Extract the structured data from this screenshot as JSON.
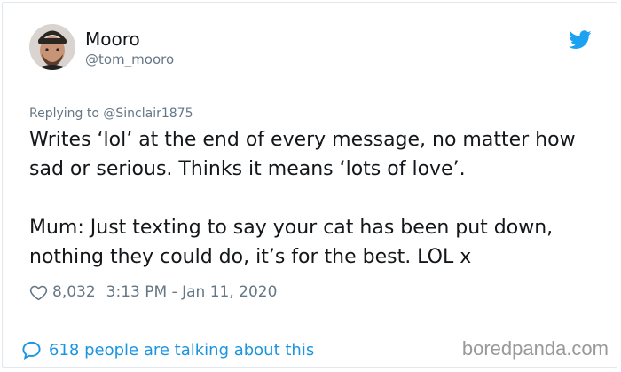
{
  "author": {
    "display_name": "Mooro",
    "handle": "@tom_mooro",
    "avatar_icon": "person-avatar"
  },
  "reply": {
    "prefix": "Replying to ",
    "target": "@Sinclair1875"
  },
  "tweet": {
    "text": "Writes ‘lol’ at the end of every message, no matter how sad or serious. Thinks it means ‘lots of love’.\n\nMum: Just texting to say your cat has been put down, nothing they could do, it’s for the best. LOL x"
  },
  "meta": {
    "like_icon": "heart-icon",
    "likes": "8,032",
    "timestamp": "3:13 PM - Jan 11, 2020"
  },
  "footer": {
    "conversation_icon": "speech-bubble-icon",
    "talking_label": "618 people are talking about this",
    "watermark": "boredpanda.com"
  },
  "colors": {
    "twitter_blue": "#1da1f2",
    "link_blue": "#1b95e0",
    "secondary_text": "#657786",
    "primary_text": "#14171a",
    "border": "#e1e8ed"
  }
}
